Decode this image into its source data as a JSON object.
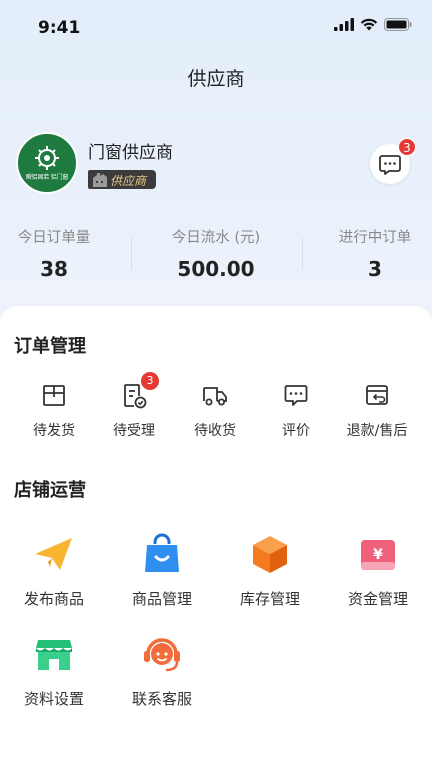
{
  "status_bar": {
    "time": "9:41"
  },
  "nav": {
    "title": "供应商"
  },
  "profile": {
    "avatar_text": "瞬铝固若 铝门窗",
    "shop_name": "门窗供应商",
    "badge": "供应商",
    "message_count": "3"
  },
  "stats": [
    {
      "label": "今日订单量",
      "value": "38"
    },
    {
      "label": "今日流水 (元)",
      "value": "500.00"
    },
    {
      "label": "进行中订单",
      "value": "3"
    }
  ],
  "order_section": {
    "title": "订单管理",
    "items": [
      {
        "label": "待发货",
        "icon": "package-icon"
      },
      {
        "label": "待受理",
        "icon": "checklist-icon",
        "badge": "3"
      },
      {
        "label": "待收货",
        "icon": "truck-icon"
      },
      {
        "label": "评价",
        "icon": "comment-icon"
      },
      {
        "label": "退款/售后",
        "icon": "refund-icon"
      }
    ]
  },
  "shop_section": {
    "title": "店铺运营",
    "items": [
      {
        "label": "发布商品",
        "icon": "paper-plane-icon",
        "color": "#f7b531"
      },
      {
        "label": "商品管理",
        "icon": "shopping-bag-icon",
        "color": "#2f8ff0"
      },
      {
        "label": "库存管理",
        "icon": "box-icon",
        "color": "#f47b20"
      },
      {
        "label": "资金管理",
        "icon": "money-icon",
        "color": "#f1607b"
      },
      {
        "label": "资料设置",
        "icon": "store-icon",
        "color": "#24c07a"
      },
      {
        "label": "联系客服",
        "icon": "headset-icon",
        "color": "#f26b3a"
      }
    ]
  }
}
